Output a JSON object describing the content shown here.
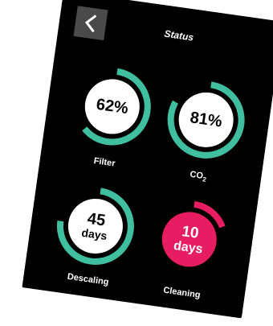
{
  "header": {
    "title": "Status",
    "back_icon": "chevron-left-icon"
  },
  "colors": {
    "ring": "#3fbf9f",
    "cleaning": "#e81c63",
    "track": "#ffffff"
  },
  "gauges": {
    "filter": {
      "value_text": "62%",
      "label": "Filter",
      "progress": 0.62
    },
    "co2": {
      "value_text": "81%",
      "label": "CO",
      "label_sub": "2",
      "progress": 0.81
    },
    "descaling": {
      "value_number": "45",
      "value_unit": "days",
      "label": "Descaling",
      "progress": 0.75
    },
    "cleaning": {
      "value_number": "10",
      "value_unit": "days",
      "label": "Cleaning",
      "progress": 0.17
    }
  }
}
